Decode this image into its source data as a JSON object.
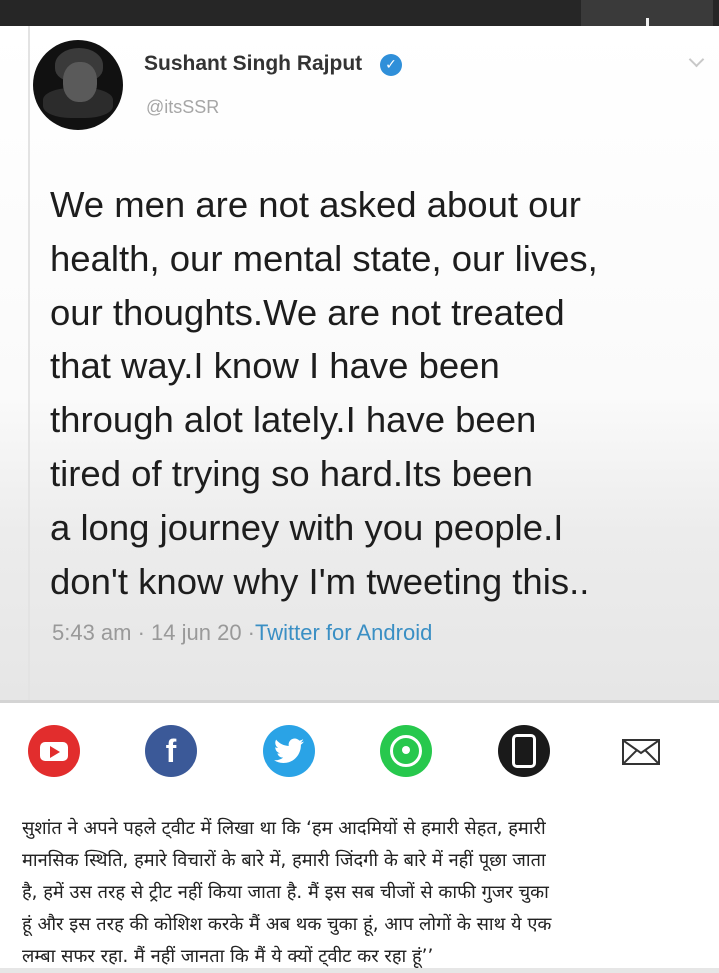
{
  "tweet": {
    "author_name": "Sushant Singh Rajput",
    "handle": "@itsSSR",
    "text_lines": [
      "We men are not asked about our",
      "health, our mental state, our lives,",
      "our thoughts.We are not treated",
      "that way.I know I have been",
      "through alot lately.I have been",
      "tired of trying so hard.Its been",
      "a long journey with you people.I",
      "don't know why I'm tweeting this.."
    ],
    "timestamp": "5:43 am · 14 jun 20 ·",
    "source": "Twitter for Android",
    "verified_icon": "verified-badge-icon",
    "colors": {
      "verified": "#2f8fd9",
      "source_link": "#3a8fc4"
    }
  },
  "share": {
    "facebook_glyph": "f",
    "icons": [
      "youtube-icon",
      "facebook-icon",
      "twitter-icon",
      "whatsapp-icon",
      "phone-icon",
      "mail-icon"
    ],
    "colors": {
      "youtube": "#e22d2d",
      "facebook": "#3b5998",
      "twitter": "#2aa3e6",
      "whatsapp": "#27c84d",
      "phone": "#1a1a1a"
    }
  },
  "article": {
    "lines": [
      "सुशांत ने अपने पहले ट्वीट में लिखा था कि ‘हम आदमियों से हमारी सेहत, हमारी",
      "मानसिक स्थिति, हमारे विचारों के बारे में, हमारी जिंदगी के बारे में नहीं पूछा जाता",
      "है, हमें उस तरह से ट्रीट नहीं किया जाता है. मैं इस सब चीजों से काफी गुजर चुका",
      "हूं और इस तरह की कोशिश करके मैं अब थक चुका हूं, आप लोगों के साथ ये एक",
      "लम्बा सफर रहा. मैं नहीं जानता कि मैं ये क्यों ट्वीट कर रहा हूं’’"
    ]
  }
}
